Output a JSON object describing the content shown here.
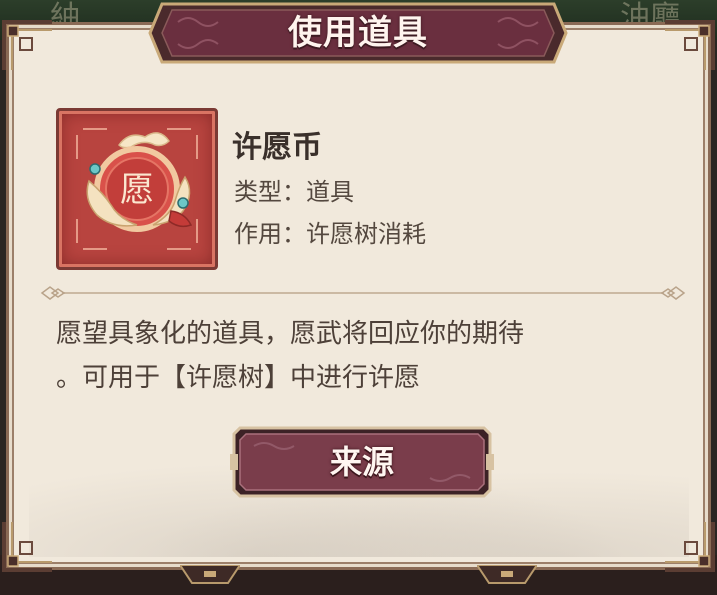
{
  "background": {
    "left_text": "紬",
    "right_text": "油廳"
  },
  "dialog": {
    "title": "使用道具"
  },
  "item": {
    "icon": "wish-coin-icon",
    "icon_char": "愿",
    "name": "许愿币",
    "type_line": "类型：道具",
    "use_line": "作用：许愿树消耗"
  },
  "description": {
    "line1": "愿望具象化的道具，愿武将回应你的期待",
    "line2": "。可用于【许愿树】中进行许愿"
  },
  "button": {
    "source_label": "来源"
  },
  "colors": {
    "panel_bg": "#f1e9dc",
    "title_bar": "#6a2f3f",
    "button": "#7a3d4b",
    "frame_gold": "#b89a6c",
    "icon_red": "#b8443f"
  }
}
